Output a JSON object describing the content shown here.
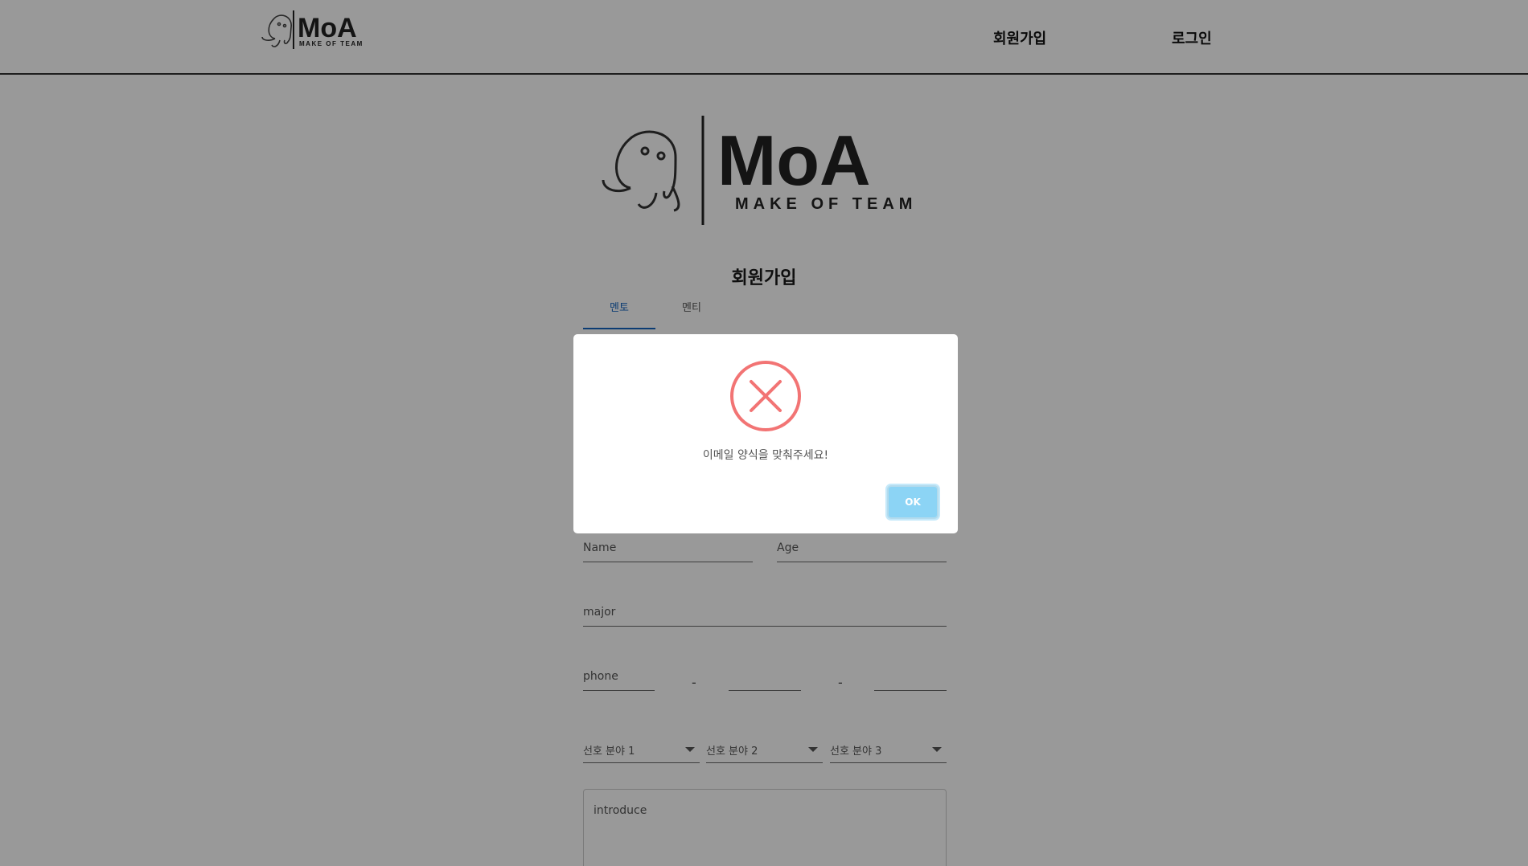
{
  "header": {
    "logo_title": "MoA",
    "logo_subtitle": "MAKE OF TEAM",
    "nav": {
      "signup": "회원가입",
      "login": "로그인"
    }
  },
  "main": {
    "logo_title": "MoA",
    "logo_subtitle": "MAKE OF TEAM",
    "title": "회원가입",
    "tabs": [
      {
        "label": "멘토"
      },
      {
        "label": "멘티"
      }
    ],
    "form": {
      "name_placeholder": "Name",
      "age_placeholder": "Age",
      "major_placeholder": "major",
      "phone_placeholder": "phone",
      "phone_separator": "-",
      "selects": [
        "선호 분야 1",
        "선호 분야 2",
        "선호 분야 3"
      ],
      "introduce_placeholder": "introduce"
    }
  },
  "modal": {
    "icon": "error-x-icon",
    "message": "이메일 양식을 맞춰주세요!",
    "ok_label": "OK",
    "colors": {
      "error": "#f27474",
      "button": "#8cd4f5"
    }
  }
}
